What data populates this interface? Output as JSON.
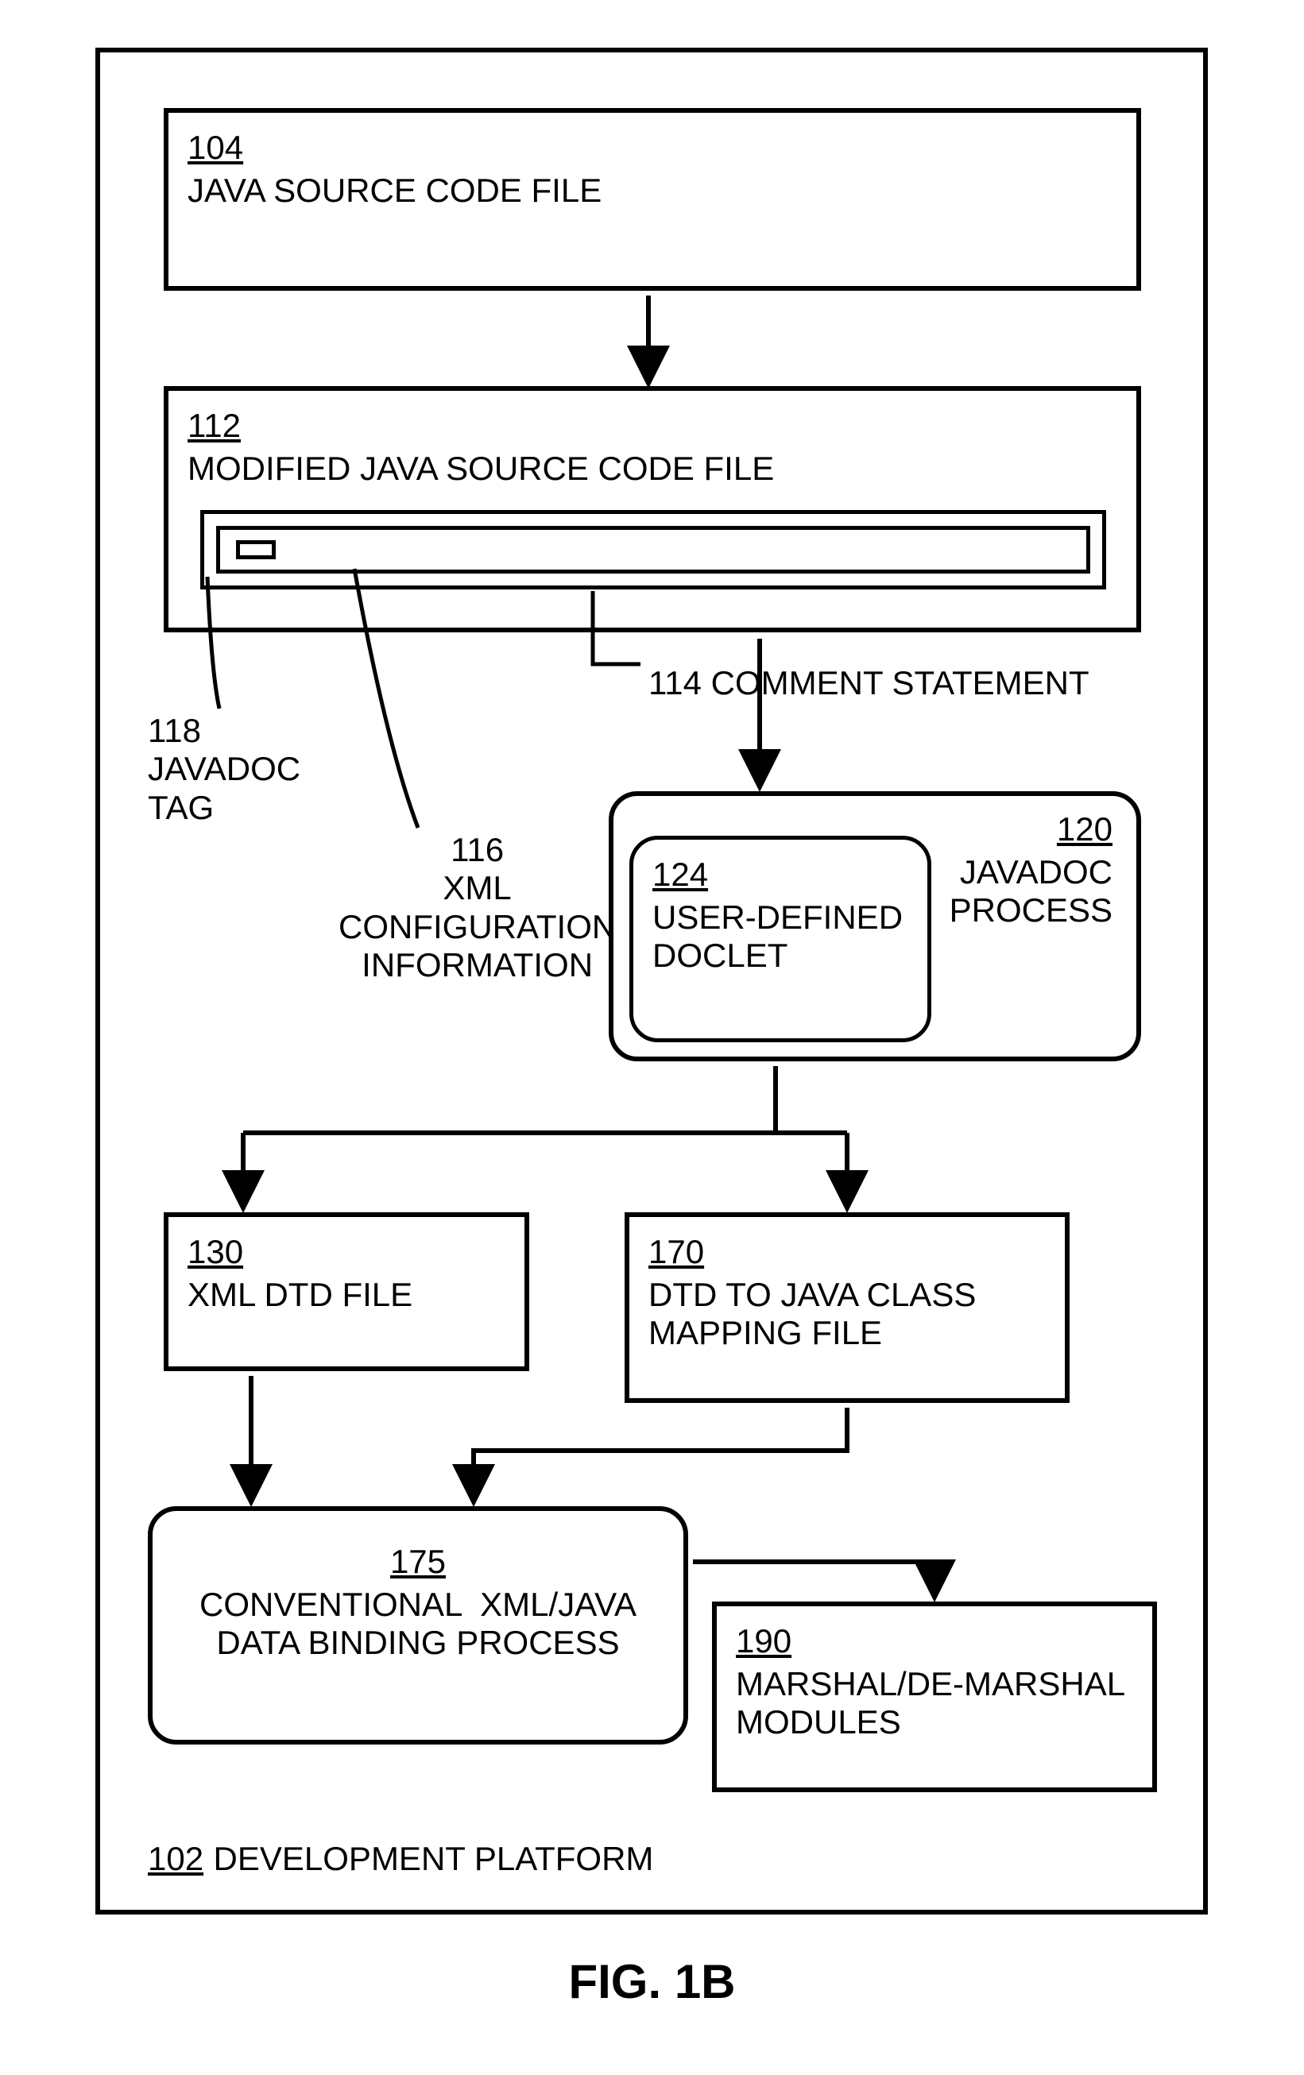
{
  "figure_caption": "FIG. 1B",
  "platform": {
    "ref": "102",
    "label": "DEVELOPMENT PLATFORM"
  },
  "boxes": {
    "source": {
      "ref": "104",
      "label": "JAVA SOURCE CODE FILE"
    },
    "modified": {
      "ref": "112",
      "label": "MODIFIED JAVA SOURCE CODE FILE"
    },
    "javadoc": {
      "ref": "120",
      "label": "JAVADOC PROCESS"
    },
    "doclet": {
      "ref": "124",
      "label": "USER-DEFINED DOCLET"
    },
    "dtd": {
      "ref": "130",
      "label": "XML DTD FILE"
    },
    "mapping": {
      "ref": "170",
      "label": "DTD TO JAVA CLASS MAPPING FILE"
    },
    "binding": {
      "ref": "175",
      "label": "CONVENTIONAL  XML/JAVA DATA BINDING PROCESS"
    },
    "marshal": {
      "ref": "190",
      "label": "MARSHAL/DE-MARSHAL MODULES"
    }
  },
  "callouts": {
    "comment": {
      "ref": "114",
      "label": "COMMENT STATEMENT"
    },
    "xmlconf": {
      "ref": "116",
      "label": "XML CONFIGURATION INFORMATION"
    },
    "tag": {
      "ref": "118",
      "label": "JAVADOC TAG"
    }
  }
}
